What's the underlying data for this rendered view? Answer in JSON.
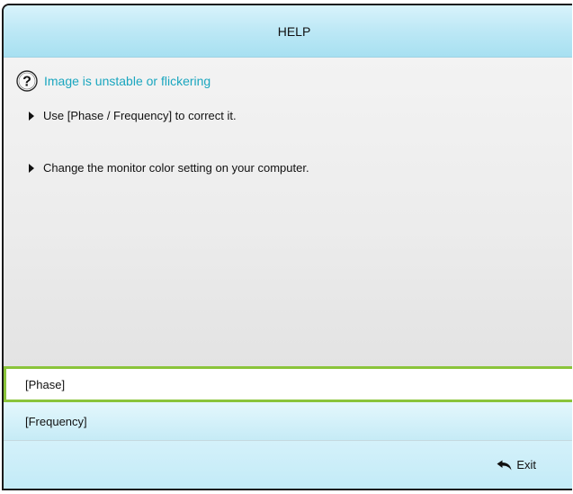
{
  "header": {
    "title": "HELP"
  },
  "topic": {
    "icon": "question-circle-icon",
    "title": "Image is unstable or flickering"
  },
  "bullets": [
    "Use [Phase / Frequency] to correct it.",
    "Change the monitor color setting on your computer."
  ],
  "options": [
    {
      "label": "[Phase]",
      "selected": true
    },
    {
      "label": "[Frequency]",
      "selected": false
    }
  ],
  "footer": {
    "exit_icon": "return-arrow-icon",
    "exit_label": "Exit"
  },
  "colors": {
    "topic_text": "#1aa6bf",
    "selection_border": "#8ac43a",
    "header_bg": "#bfe9f6"
  }
}
